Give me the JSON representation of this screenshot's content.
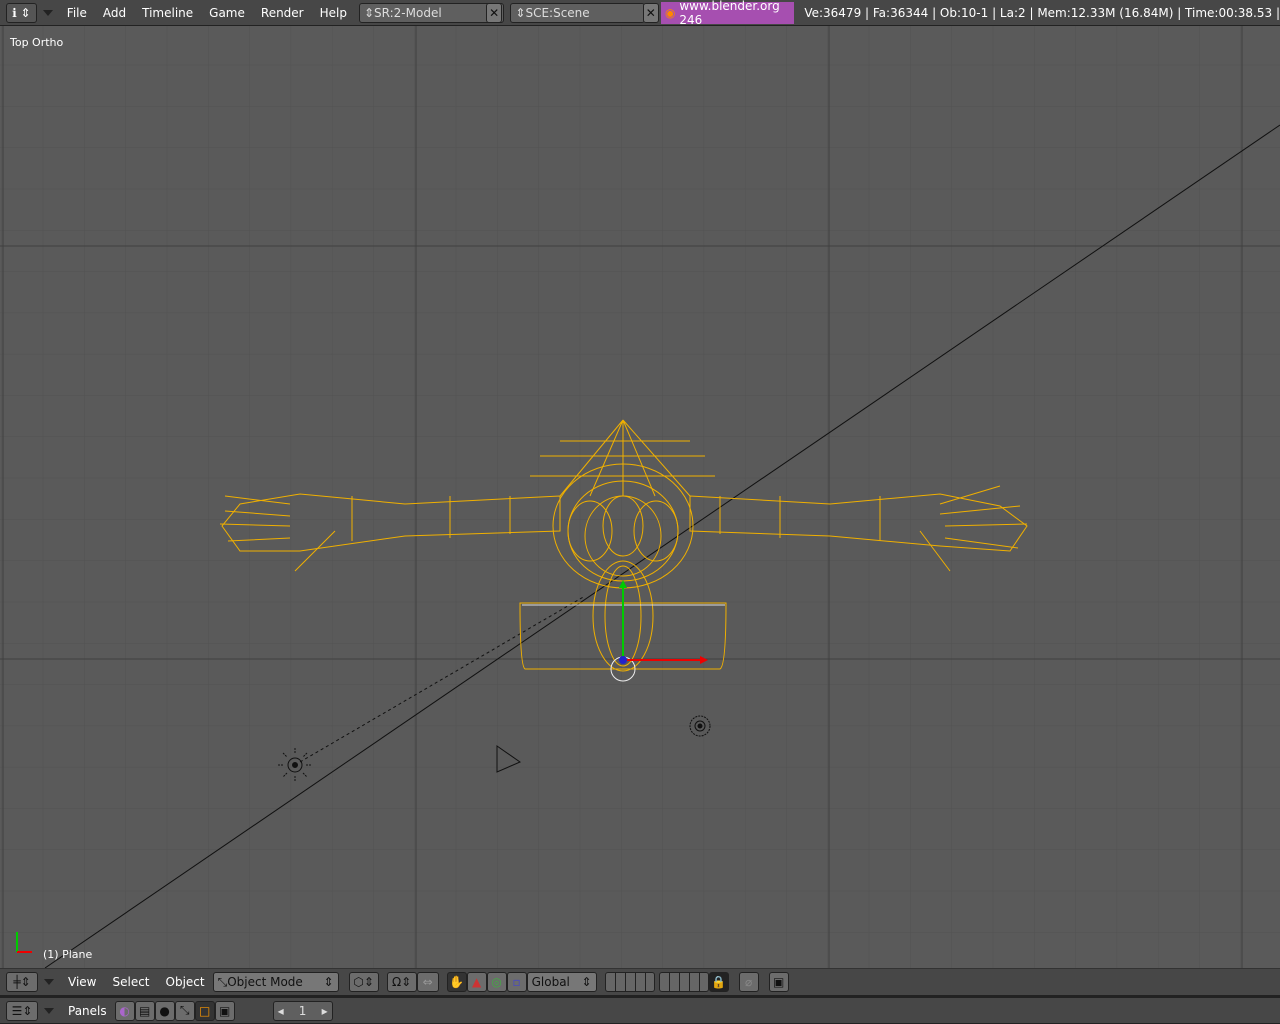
{
  "top": {
    "menus": [
      "File",
      "Add",
      "Timeline",
      "Game",
      "Render",
      "Help"
    ],
    "screen": "SR:2-Model",
    "scene": "SCE:Scene",
    "version": "www.blender.org 246",
    "stats": "Ve:36479 | Fa:36344 | Ob:10-1 | La:2  | Mem:12.33M (16.84M)  | Time:00:38.53 |",
    "accent": "#a64fb0"
  },
  "viewport": {
    "view_name": "Top Ortho",
    "object_label": "(1) Plane",
    "selection_color": "#f0b000"
  },
  "header3d": {
    "menus": [
      "View",
      "Select",
      "Object"
    ],
    "mode": "Object Mode",
    "orientation": "Global"
  },
  "buttons": {
    "panels": "Panels",
    "frame": "1"
  }
}
